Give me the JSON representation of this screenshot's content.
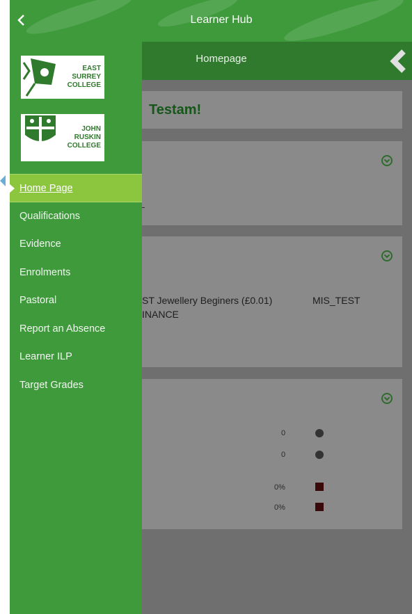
{
  "header": {
    "back_icon": "chevron-left-icon",
    "title": "Learner Hub"
  },
  "subheader": {
    "title": "Homepage",
    "collapse_icon": "chevron-left-icon"
  },
  "logos": {
    "east_surrey": [
      "EAST",
      "SURREY",
      "COLLEGE"
    ],
    "john_ruskin": [
      "JOHN",
      "RUSKIN",
      "COLLEGE"
    ]
  },
  "menu": {
    "items": [
      {
        "label": "Home Page",
        "active": true
      },
      {
        "label": "Qualifications"
      },
      {
        "label": "Evidence"
      },
      {
        "label": "Enrolments"
      },
      {
        "label": "Pastoral"
      },
      {
        "label": "Report an Absence"
      },
      {
        "label": "Learner ILP"
      },
      {
        "label": "Target Grades"
      }
    ]
  },
  "content": {
    "greeting": "Testam!",
    "enrolment": {
      "course": "ST Jewellery Beginers (£0.01)",
      "code": "MIS_TEST",
      "line2": "INANCE"
    },
    "stats": [
      {
        "value": "0",
        "marker": "dot"
      },
      {
        "value": "0",
        "marker": "dot"
      },
      {
        "value": "0%",
        "marker": "square"
      },
      {
        "value": "0%",
        "marker": "square"
      }
    ]
  },
  "colors": {
    "primary_green": "#3e9a3b",
    "active_item": "#8cc63f",
    "dark_green": "#2f7a2d"
  }
}
